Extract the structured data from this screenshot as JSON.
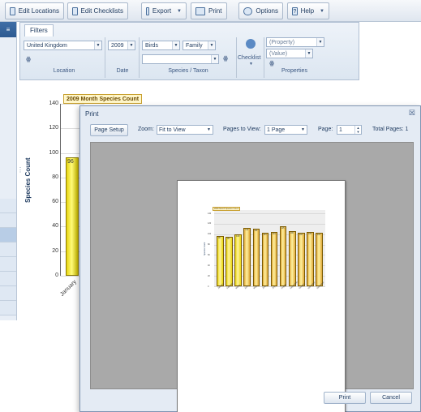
{
  "toolbar": {
    "edit_locations": "Edit Locations",
    "edit_checklists": "Edit Checklists",
    "export": "Export",
    "print": "Print",
    "options": "Options",
    "help": "Help"
  },
  "filters": {
    "tab": "Filters",
    "country": "United Kingdom",
    "year": "2009",
    "group": "Birds",
    "rank": "Family",
    "taxon_value": "",
    "checklist_label": "Checklist",
    "property": "(Property)",
    "value": "(Value)",
    "group_labels": {
      "location": "Location",
      "date": "Date",
      "species": "Species / Taxon",
      "properties": "Properties"
    }
  },
  "background_chart": {
    "title": "2009 Month Species Count",
    "ylabel": "Species Count",
    "yticks": [
      "140",
      "120",
      "100",
      "80",
      "60",
      "40",
      "20",
      "0"
    ],
    "first_bar_value": "96",
    "first_category": "January"
  },
  "print_dialog": {
    "title": "Print",
    "page_setup": "Page Setup",
    "zoom_label": "Zoom:",
    "zoom_value": "Fit to View",
    "pages_to_view_label": "Pages to View:",
    "pages_to_view_value": "1 Page",
    "page_label": "Page:",
    "page_value": "1",
    "total_pages": "Total Pages: 1",
    "print_button": "Print",
    "cancel_button": "Cancel"
  },
  "chart_data": {
    "type": "bar",
    "title": "2009 Month Species Count",
    "xlabel": "",
    "ylabel": "Species Count",
    "ylim": [
      0,
      140
    ],
    "categories": [
      "January",
      "February",
      "March",
      "April",
      "May",
      "June",
      "July",
      "August",
      "September",
      "October",
      "November",
      "December"
    ],
    "values": [
      96,
      95,
      100,
      112,
      110,
      103,
      104,
      115,
      106,
      102,
      105,
      103
    ],
    "colors": [
      "#e8d90f",
      "#e8d90f",
      "#e8d90f",
      "#e0a93a",
      "#e0a93a",
      "#e0a93a",
      "#e0a93a",
      "#e0a93a",
      "#e0a93a",
      "#e0a93a",
      "#e0a93a",
      "#e0a93a"
    ]
  }
}
